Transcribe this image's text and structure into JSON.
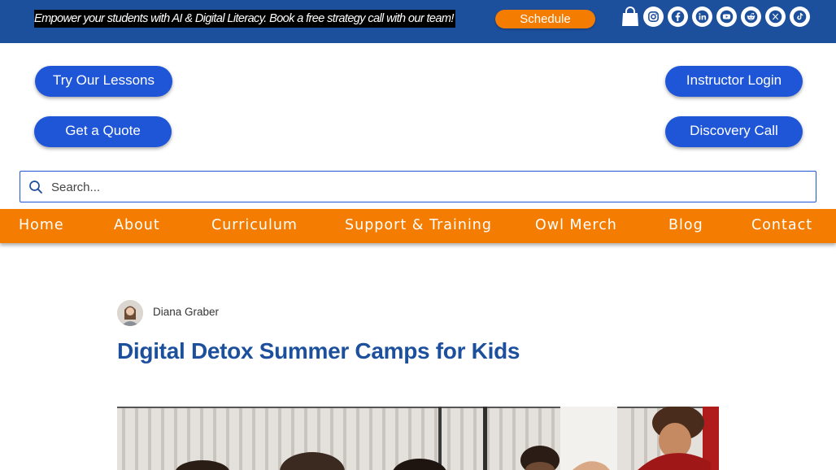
{
  "banner": {
    "promo_text": "Empower your students with AI & Digital Literacy. Book a free strategy call with our team!",
    "schedule_label": "Schedule",
    "colors": {
      "banner_bg": "#1c4f9c",
      "accent": "#f47c00"
    }
  },
  "header_icons": {
    "cart": "shopping-bag-icon",
    "social": [
      "instagram-icon",
      "facebook-icon",
      "linkedin-icon",
      "youtube-icon",
      "reddit-icon",
      "x-icon",
      "tiktok-icon"
    ]
  },
  "actions": {
    "try_lessons": "Try Our Lessons",
    "get_quote": "Get a Quote",
    "instructor_login": "Instructor Login",
    "discovery_call": "Discovery Call",
    "button_color": "#1f56d8"
  },
  "search": {
    "placeholder": "Search..."
  },
  "nav": {
    "items": [
      "Home",
      "About",
      "Curriculum",
      "Support & Training",
      "Owl Merch",
      "Blog",
      "Contact"
    ]
  },
  "post": {
    "author": "Diana Graber",
    "title": "Digital Detox Summer Camps for Kids",
    "title_color": "#1c4f9c"
  }
}
